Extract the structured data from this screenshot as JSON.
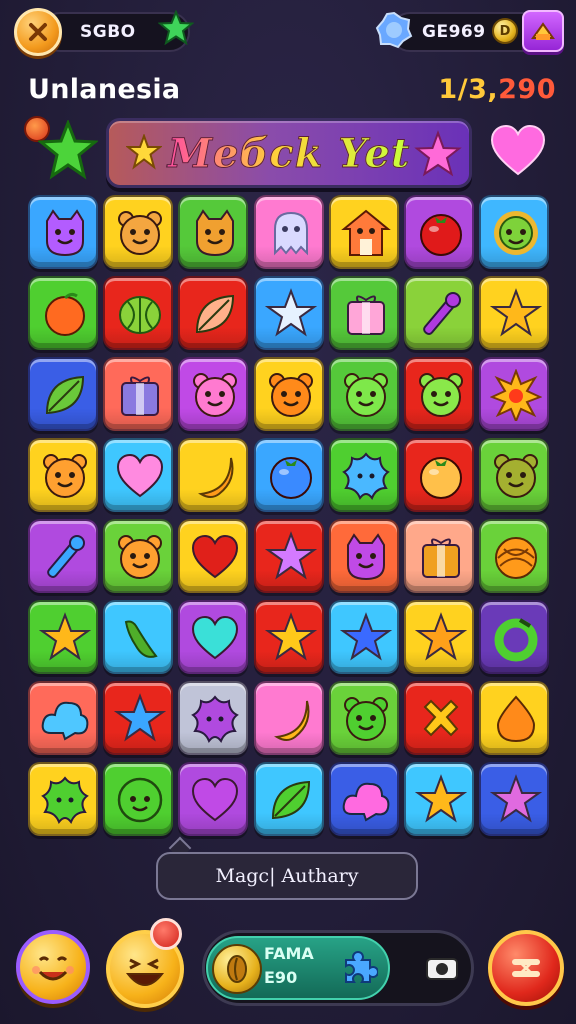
{
  "topbar": {
    "player_name": "SGBO",
    "currency": "GE969",
    "coin_glyph": "D"
  },
  "level": {
    "name": "Unlanesia",
    "score_prefix": "1/3,",
    "score_suffix": "290"
  },
  "banner": {
    "title": "Meбck Yet"
  },
  "board": {
    "rows": 8,
    "cols": 7,
    "tiles": [
      [
        {
          "bg": "#3aa7ff",
          "icon": "cat-face",
          "fg": "#b35cff"
        },
        {
          "bg": "#ffd21f",
          "icon": "bear-face",
          "fg": "#f4a640"
        },
        {
          "bg": "#55c93a",
          "icon": "cat-face",
          "fg": "#f0a030"
        },
        {
          "bg": "#ff7ad0",
          "icon": "ghost",
          "fg": "#d9d9ff"
        },
        {
          "bg": "#ffd21f",
          "icon": "house",
          "fg": "#ff7a3a"
        },
        {
          "bg": "#b04adf",
          "icon": "tomato",
          "fg": "#e01a1a"
        },
        {
          "bg": "#3fb7ff",
          "icon": "sun-face",
          "fg": "#7ed23a"
        }
      ],
      [
        {
          "bg": "#4fcf30",
          "icon": "fruit",
          "fg": "#ff6a20"
        },
        {
          "bg": "#e8261c",
          "icon": "melon",
          "fg": "#8ad23a"
        },
        {
          "bg": "#e8261c",
          "icon": "leaf",
          "fg": "#ffb08a"
        },
        {
          "bg": "#3aa7ff",
          "icon": "star",
          "fg": "#e6f2ff"
        },
        {
          "bg": "#55c93a",
          "icon": "gift",
          "fg": "#ffa6d8"
        },
        {
          "bg": "#8ad23a",
          "icon": "wand",
          "fg": "#b03ae0"
        },
        {
          "bg": "#ffd21f",
          "icon": "star",
          "fg": "#ffb81a"
        }
      ],
      [
        {
          "bg": "#3a5ee6",
          "icon": "leaf",
          "fg": "#6ac83a"
        },
        {
          "bg": "#ff6a5a",
          "icon": "gift",
          "fg": "#8a7ae0"
        },
        {
          "bg": "#c04ae6",
          "icon": "bear-face",
          "fg": "#ff7ad0"
        },
        {
          "bg": "#ffd21f",
          "icon": "bear-face",
          "fg": "#ff8a1a"
        },
        {
          "bg": "#55c93a",
          "icon": "bear-face",
          "fg": "#7ee84a"
        },
        {
          "bg": "#e8261c",
          "icon": "bear-face",
          "fg": "#8ae84a"
        },
        {
          "bg": "#b04adf",
          "icon": "flower",
          "fg": "#ffb81a"
        }
      ],
      [
        {
          "bg": "#ffd21f",
          "icon": "bear-face",
          "fg": "#ffa030"
        },
        {
          "bg": "#3fc7ff",
          "icon": "heart",
          "fg": "#ff8ae0"
        },
        {
          "bg": "#ffd21f",
          "icon": "banana",
          "fg": "#ff9a1a"
        },
        {
          "bg": "#3aa7ff",
          "icon": "tomato",
          "fg": "#3a8aff"
        },
        {
          "bg": "#4fcf30",
          "icon": "splat",
          "fg": "#4ab8ff"
        },
        {
          "bg": "#e8261c",
          "icon": "tomato",
          "fg": "#ffc04a"
        },
        {
          "bg": "#6ad23a",
          "icon": "bear-face",
          "fg": "#a4b030"
        }
      ],
      [
        {
          "bg": "#b04adf",
          "icon": "wand",
          "fg": "#3aa7ff"
        },
        {
          "bg": "#6ad23a",
          "icon": "bear-face",
          "fg": "#ffa030"
        },
        {
          "bg": "#ffd21f",
          "icon": "heart",
          "fg": "#e0201a"
        },
        {
          "bg": "#e8261c",
          "icon": "star",
          "fg": "#d47aff"
        },
        {
          "bg": "#ff6a3a",
          "icon": "cat-face",
          "fg": "#c04ae6"
        },
        {
          "bg": "#ffa88a",
          "icon": "gift",
          "fg": "#f0a020"
        },
        {
          "bg": "#6ad23a",
          "icon": "shell",
          "fg": "#ff9a1a"
        }
      ],
      [
        {
          "bg": "#4fcf30",
          "icon": "star",
          "fg": "#ffb81a"
        },
        {
          "bg": "#3fc7ff",
          "icon": "pepper",
          "fg": "#4fae2a"
        },
        {
          "bg": "#b04adf",
          "icon": "heart",
          "fg": "#3ae0d8"
        },
        {
          "bg": "#e8261c",
          "icon": "star",
          "fg": "#ffc81a"
        },
        {
          "bg": "#3fc7ff",
          "icon": "star",
          "fg": "#3a6aff"
        },
        {
          "bg": "#ffd21f",
          "icon": "star",
          "fg": "#ffa01a"
        },
        {
          "bg": "#6a3ab8",
          "icon": "ring",
          "fg": "#4fcf30"
        }
      ],
      [
        {
          "bg": "#ff6a5a",
          "icon": "cloud",
          "fg": "#4fc7ff"
        },
        {
          "bg": "#e8261c",
          "icon": "star",
          "fg": "#3aa7ff"
        },
        {
          "bg": "#c0c4d8",
          "icon": "splat",
          "fg": "#b04adf"
        },
        {
          "bg": "#ff7ad0",
          "icon": "banana",
          "fg": "#ffb81a"
        },
        {
          "bg": "#6ad23a",
          "icon": "bear-face",
          "fg": "#4fcf30"
        },
        {
          "bg": "#e8261c",
          "icon": "cross",
          "fg": "#ffc81a"
        },
        {
          "bg": "#ffd21f",
          "icon": "drop",
          "fg": "#ff8a1a"
        }
      ],
      [
        {
          "bg": "#ffd21f",
          "icon": "splat",
          "fg": "#4fcf30"
        },
        {
          "bg": "#4fcf30",
          "icon": "smiley",
          "fg": "#4fcf30"
        },
        {
          "bg": "#b04adf",
          "icon": "heart",
          "fg": "#c04ae6"
        },
        {
          "bg": "#3fc7ff",
          "icon": "leaf",
          "fg": "#4fcf30"
        },
        {
          "bg": "#3a5ee6",
          "icon": "cloud",
          "fg": "#ff6ae0"
        },
        {
          "bg": "#3fc7ff",
          "icon": "star",
          "fg": "#ffb81a"
        },
        {
          "bg": "#3a5ee6",
          "icon": "star",
          "fg": "#e06ae0"
        }
      ]
    ]
  },
  "hint": {
    "text": "Magc| Authary"
  },
  "bottom": {
    "booster_line1": "FAMA",
    "booster_line2": "E90"
  },
  "colors": {
    "background": "#221d38",
    "accent_orange": "#f39a1d",
    "score_gold": "#ffc93a",
    "score_red": "#ff5a3a"
  }
}
